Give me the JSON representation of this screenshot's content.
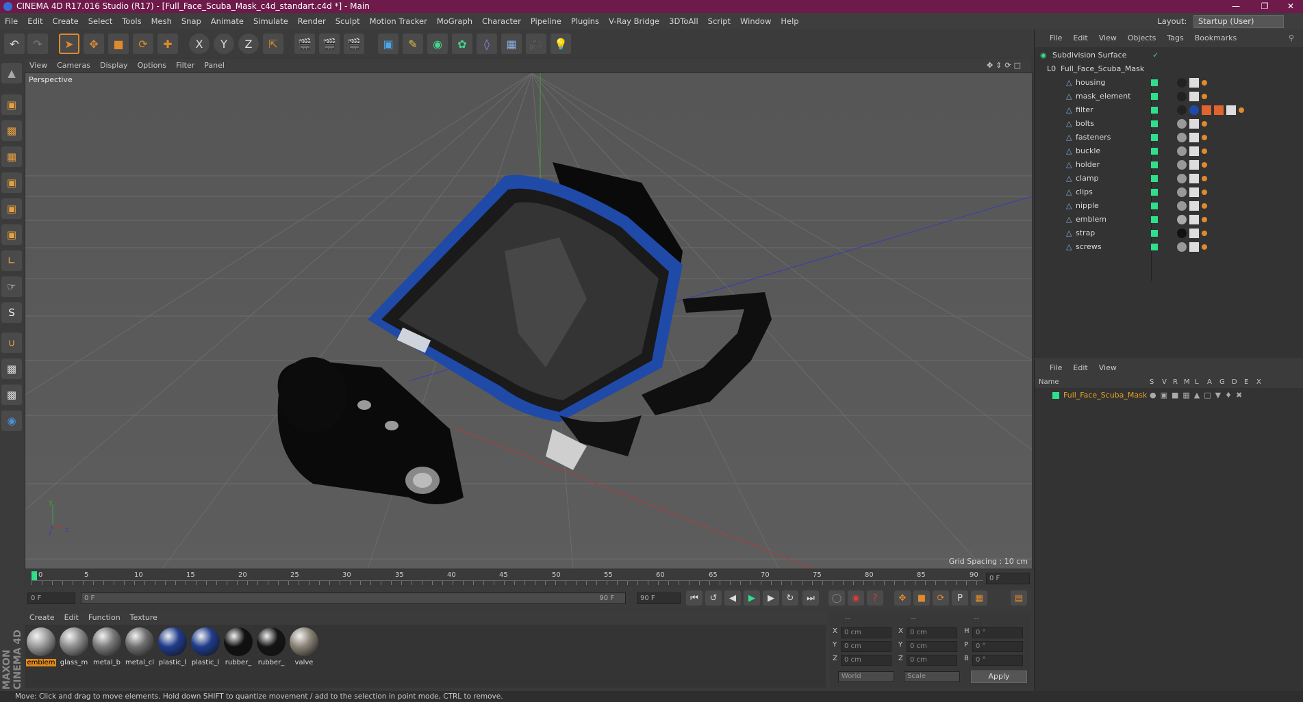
{
  "window": {
    "title": "CINEMA 4D R17.016 Studio (R17) - [Full_Face_Scuba_Mask_c4d_standart.c4d *] - Main",
    "layout_label": "Layout:",
    "layout_value": "Startup (User)"
  },
  "menubar": [
    "File",
    "Edit",
    "Create",
    "Select",
    "Tools",
    "Mesh",
    "Snap",
    "Animate",
    "Simulate",
    "Render",
    "Sculpt",
    "Motion Tracker",
    "MoGraph",
    "Character",
    "Pipeline",
    "Plugins",
    "V-Ray Bridge",
    "3DToAll",
    "Script",
    "Window",
    "Help"
  ],
  "viewport": {
    "menu": [
      "View",
      "Cameras",
      "Display",
      "Options",
      "Filter",
      "Panel"
    ],
    "label": "Perspective",
    "grid_spacing": "Grid Spacing : 10 cm",
    "axis_y": "y",
    "axis_z": "z"
  },
  "timeline": {
    "ticks": [
      "0",
      "5",
      "10",
      "15",
      "20",
      "25",
      "30",
      "35",
      "40",
      "45",
      "50",
      "55",
      "60",
      "65",
      "70",
      "75",
      "80",
      "85",
      "90"
    ],
    "current_frame": "0 F",
    "start_field": "0 F",
    "range_start": "0 F",
    "range_end": "90 F",
    "end_field": "90 F"
  },
  "materials": {
    "menu": [
      "Create",
      "Edit",
      "Function",
      "Texture"
    ],
    "items": [
      {
        "label": "emblem",
        "color": "#9a9a9a",
        "selected": true
      },
      {
        "label": "glass_m",
        "color": "#8c8c8c",
        "selected": false
      },
      {
        "label": "metal_b",
        "color": "#7a7a7a",
        "selected": false
      },
      {
        "label": "metal_cl",
        "color": "#6f6f6f",
        "selected": false
      },
      {
        "label": "plastic_l",
        "color": "#1f3c8c",
        "selected": false
      },
      {
        "label": "plastic_l",
        "color": "#1f3c8c",
        "selected": false
      },
      {
        "label": "rubber_",
        "color": "#101010",
        "selected": false
      },
      {
        "label": "rubber_",
        "color": "#141414",
        "selected": false
      },
      {
        "label": "valve",
        "color": "#8a8376",
        "selected": false
      }
    ],
    "maxon_logo": "MAXON CINEMA 4D"
  },
  "coords": {
    "headers": [
      "--",
      "--",
      "--"
    ],
    "rows": [
      {
        "l1": "X",
        "v1": "0 cm",
        "l2": "X",
        "v2": "0 cm",
        "l3": "H",
        "v3": "0 °"
      },
      {
        "l1": "Y",
        "v1": "0 cm",
        "l2": "Y",
        "v2": "0 cm",
        "l3": "P",
        "v3": "0 °"
      },
      {
        "l1": "Z",
        "v1": "0 cm",
        "l2": "Z",
        "v2": "0 cm",
        "l3": "B",
        "v3": "0 °"
      }
    ],
    "mode1": "World",
    "mode2": "Scale",
    "apply": "Apply"
  },
  "objects": {
    "menu": [
      "File",
      "Edit",
      "View",
      "Objects",
      "Tags",
      "Bookmarks"
    ],
    "root": "Subdivision Surface",
    "group": "Full_Face_Scuba_Mask",
    "children": [
      "housing",
      "mask_element",
      "filter",
      "bolts",
      "fasteners",
      "buckle",
      "holder",
      "clamp",
      "clips",
      "nipple",
      "emblem",
      "strap",
      "screws"
    ]
  },
  "attributes": {
    "menu": [
      "File",
      "Edit",
      "View"
    ],
    "columns": [
      "Name",
      "S",
      "V",
      "R",
      "M",
      "L",
      "A",
      "G",
      "D",
      "E",
      "X"
    ],
    "row_name": "Full_Face_Scuba_Mask"
  },
  "status": "Move: Click and drag to move elements. Hold down SHIFT to quantize movement / add to the selection in point mode, CTRL to remove.",
  "colors": {
    "title_bar": "#6e1a4a",
    "accent": "#e08a2e",
    "layer_green": "#2ee08a",
    "mask_blue": "#1f4aa8"
  }
}
